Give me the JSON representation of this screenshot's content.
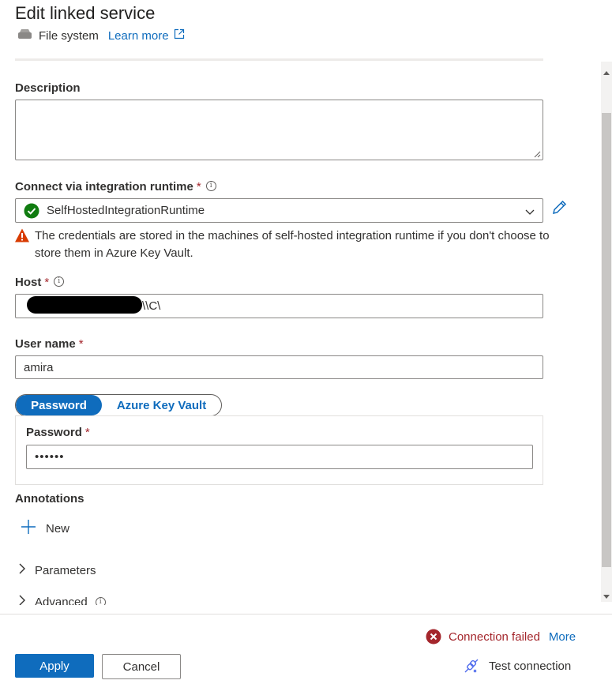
{
  "header": {
    "title": "Edit linked service",
    "service_type": "File system",
    "learn_more": "Learn more"
  },
  "description": {
    "label": "Description",
    "value": ""
  },
  "runtime": {
    "label": "Connect via integration runtime",
    "required_mark": "*",
    "value": "SelfHostedIntegrationRuntime",
    "warning": "The credentials are stored in the machines of self-hosted integration runtime if you don't choose to store them in Azure Key Vault."
  },
  "host": {
    "label": "Host",
    "required_mark": "*",
    "value": "\\\\C\\"
  },
  "username": {
    "label": "User name",
    "required_mark": "*",
    "value": "amira"
  },
  "auth_toggle": {
    "selected": "Password",
    "other": "Azure Key Vault"
  },
  "password": {
    "label": "Password",
    "required_mark": "*",
    "value": "••••••"
  },
  "annotations": {
    "label": "Annotations",
    "new_label": "New"
  },
  "sections": {
    "parameters": "Parameters",
    "advanced": "Advanced"
  },
  "footer": {
    "status_text": "Connection failed",
    "more_link": "More",
    "apply": "Apply",
    "cancel": "Cancel",
    "test_connection": "Test connection"
  },
  "colors": {
    "accent": "#0f6cbd",
    "error": "#a4262c",
    "success": "#107c10",
    "warning": "#d83b01"
  },
  "icons": {
    "file_system": "drive-icon",
    "external": "external-link-icon",
    "success": "check-circle-icon",
    "warning": "warning-icon",
    "edit": "pencil-icon",
    "add": "plus-icon",
    "expand": "chevron-right-icon",
    "error": "error-circle-icon",
    "test": "plug-icon"
  }
}
